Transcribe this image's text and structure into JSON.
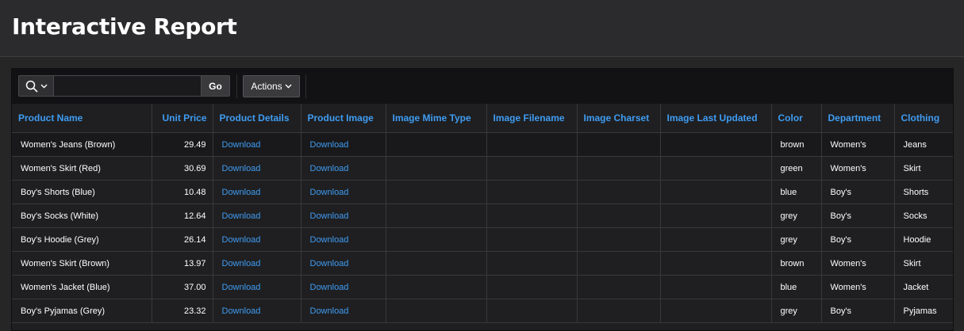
{
  "header": {
    "title": "Interactive Report"
  },
  "toolbar": {
    "search_value": "",
    "go_label": "Go",
    "actions_label": "Actions",
    "search_icon": "search-icon",
    "dropdown_icon": "chevron-down-icon"
  },
  "columns": [
    "Product Name",
    "Unit Price",
    "Product Details",
    "Product Image",
    "Image Mime Type",
    "Image Filename",
    "Image Charset",
    "Image Last Updated",
    "Color",
    "Department",
    "Clothing"
  ],
  "rows": [
    {
      "product_name": "Women's Jeans (Brown)",
      "unit_price": "29.49",
      "details": "Download",
      "image": "Download",
      "mime": "",
      "filename": "",
      "charset": "",
      "updated": "",
      "color": "brown",
      "department": "Women's",
      "clothing": "Jeans"
    },
    {
      "product_name": "Women's Skirt (Red)",
      "unit_price": "30.69",
      "details": "Download",
      "image": "Download",
      "mime": "",
      "filename": "",
      "charset": "",
      "updated": "",
      "color": "green",
      "department": "Women's",
      "clothing": "Skirt"
    },
    {
      "product_name": "Boy's Shorts (Blue)",
      "unit_price": "10.48",
      "details": "Download",
      "image": "Download",
      "mime": "",
      "filename": "",
      "charset": "",
      "updated": "",
      "color": "blue",
      "department": "Boy's",
      "clothing": "Shorts"
    },
    {
      "product_name": "Boy's Socks (White)",
      "unit_price": "12.64",
      "details": "Download",
      "image": "Download",
      "mime": "",
      "filename": "",
      "charset": "",
      "updated": "",
      "color": "grey",
      "department": "Boy's",
      "clothing": "Socks"
    },
    {
      "product_name": "Boy's Hoodie (Grey)",
      "unit_price": "26.14",
      "details": "Download",
      "image": "Download",
      "mime": "",
      "filename": "",
      "charset": "",
      "updated": "",
      "color": "grey",
      "department": "Boy's",
      "clothing": "Hoodie"
    },
    {
      "product_name": "Women's Skirt (Brown)",
      "unit_price": "13.97",
      "details": "Download",
      "image": "Download",
      "mime": "",
      "filename": "",
      "charset": "",
      "updated": "",
      "color": "brown",
      "department": "Women's",
      "clothing": "Skirt"
    },
    {
      "product_name": "Women's Jacket (Blue)",
      "unit_price": "37.00",
      "details": "Download",
      "image": "Download",
      "mime": "",
      "filename": "",
      "charset": "",
      "updated": "",
      "color": "blue",
      "department": "Women's",
      "clothing": "Jacket"
    },
    {
      "product_name": "Boy's Pyjamas (Grey)",
      "unit_price": "23.32",
      "details": "Download",
      "image": "Download",
      "mime": "",
      "filename": "",
      "charset": "",
      "updated": "",
      "color": "grey",
      "department": "Boy's",
      "clothing": "Pyjamas"
    }
  ],
  "theme": {
    "link_color": "#3f9cf2",
    "background": "#262626"
  }
}
